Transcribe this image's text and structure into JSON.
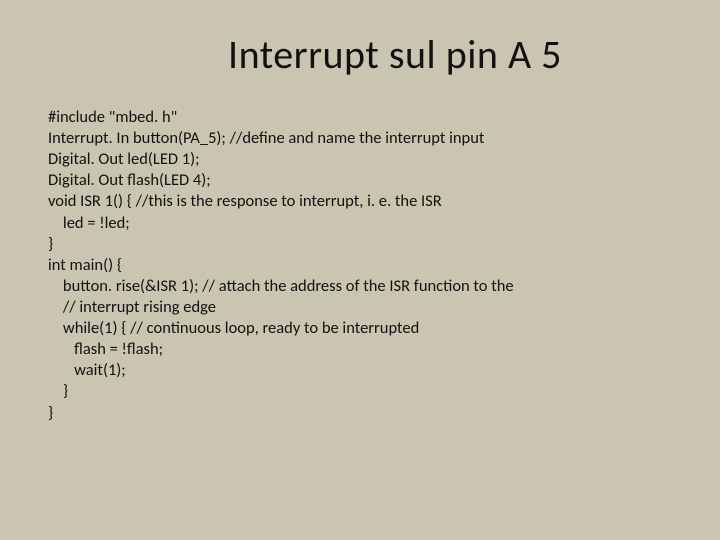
{
  "slide": {
    "title": "Interrupt sul pin A 5",
    "code_lines": [
      "#include \"mbed. h\"",
      "Interrupt. In button(PA_5); //define and name the interrupt input",
      "Digital. Out led(LED 1);",
      "Digital. Out flash(LED 4);",
      "void ISR 1() { //this is the response to interrupt, i. e. the ISR",
      "    led = !led;",
      "}",
      "int main() {",
      "    button. rise(&ISR 1); // attach the address of the ISR function to the",
      "    // interrupt rising edge",
      "    while(1) { // continuous loop, ready to be interrupted",
      "       flash = !flash;",
      "       wait(1);",
      "    }",
      "}"
    ]
  }
}
